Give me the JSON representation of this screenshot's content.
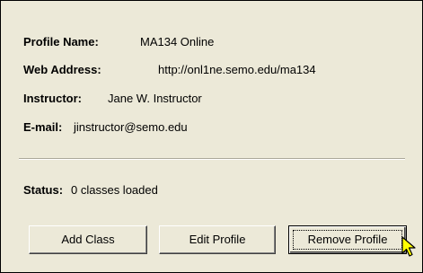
{
  "profile": {
    "name_label": "Profile Name:",
    "name_value": "MA134 Online",
    "web_label": "Web Address:",
    "web_value": "http://onl1ne.semo.edu/ma134",
    "instructor_label": "Instructor:",
    "instructor_value": "Jane W. Instructor",
    "email_label": "E-mail:",
    "email_value": "jinstructor@semo.edu"
  },
  "status": {
    "label": "Status:",
    "value": "0 classes loaded"
  },
  "buttons": {
    "add_class": "Add Class",
    "edit_profile": "Edit Profile",
    "remove_profile": "Remove Profile"
  },
  "colors": {
    "panel": "#ece9d8",
    "cursor": "#ffff00"
  }
}
